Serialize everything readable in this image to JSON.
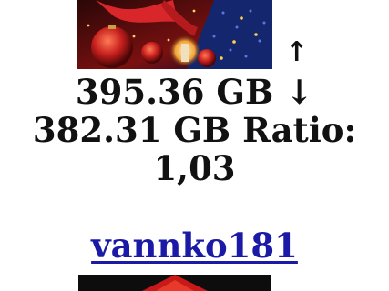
{
  "stats": {
    "upload_arrow": "↑",
    "line1": "395.36 GB ↓",
    "line2": "382.31 GB Ratio:",
    "line3": "1,03"
  },
  "user": {
    "name": "vannko181"
  },
  "colors": {
    "link": "#1a1aa6",
    "text": "#111111",
    "banner_bg": "#1a0505",
    "ornament_red": "#c8201e",
    "tree_blue": "#1b2f8a"
  },
  "images": {
    "top_banner": "christmas-ornaments-banner",
    "bottom_banner": "red-decoration-banner"
  }
}
